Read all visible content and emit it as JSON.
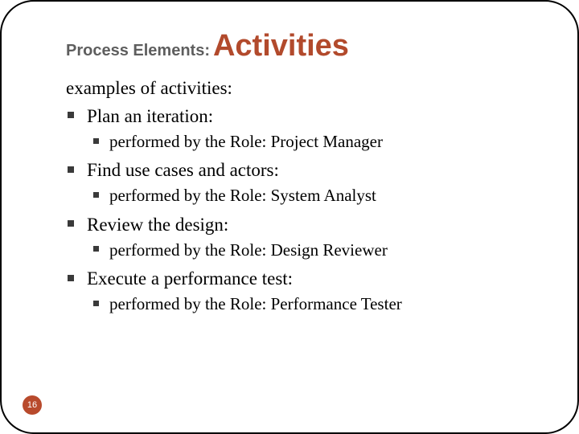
{
  "title": {
    "prefix": "Process Elements:",
    "main": "Activities"
  },
  "intro": "examples of activities:",
  "items": [
    {
      "label": "Plan an iteration:",
      "sub": "performed by the Role: Project Manager"
    },
    {
      "label": "Find use cases and actors:",
      "sub": "performed by the Role: System Analyst"
    },
    {
      "label": "Review the design:",
      "sub": "performed by the Role: Design Reviewer"
    },
    {
      "label": "Execute a performance test:",
      "sub": "performed by the Role: Performance Tester"
    }
  ],
  "page_number": "16"
}
